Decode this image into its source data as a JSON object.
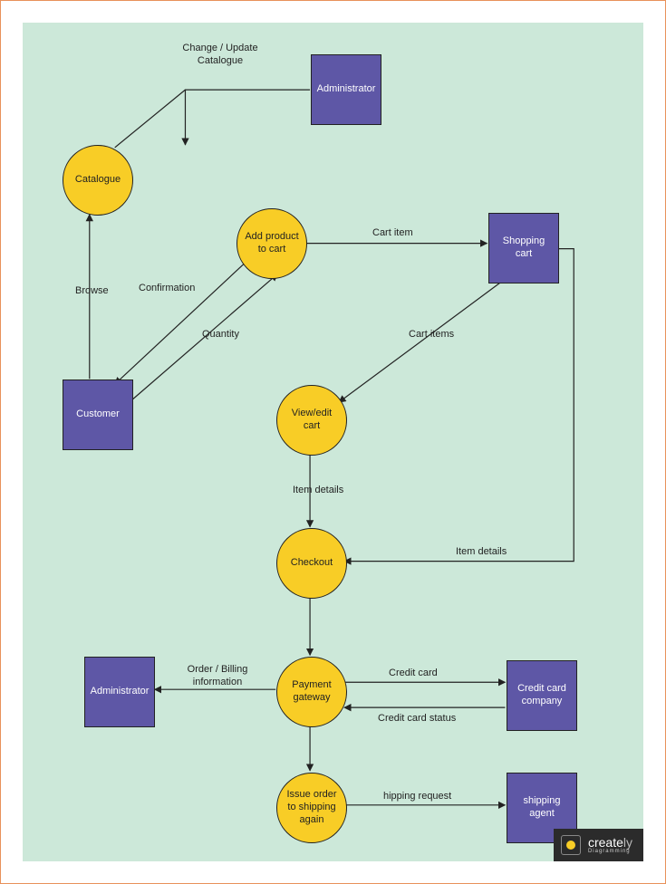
{
  "nodes": {
    "administrator_top": {
      "label": "Administrator"
    },
    "catalogue": {
      "label": "Catalogue"
    },
    "add_product": {
      "label": "Add product to cart"
    },
    "shopping_cart": {
      "label": "Shopping cart"
    },
    "customer": {
      "label": "Customer"
    },
    "view_edit_cart": {
      "label": "View/edit cart"
    },
    "checkout": {
      "label": "Checkout"
    },
    "administrator_bot": {
      "label": "Administrator"
    },
    "payment_gateway": {
      "label": "Payment gateway"
    },
    "credit_card_company": {
      "label": "Credit card company"
    },
    "issue_order": {
      "label": "Issue order to shipping again"
    },
    "shipping_agent": {
      "label": "shipping agent"
    }
  },
  "edges": {
    "change_update": {
      "label": "Change / Update Catalogue"
    },
    "browse": {
      "label": "Browse"
    },
    "confirmation": {
      "label": "Confirmation"
    },
    "quantity": {
      "label": "Quantity"
    },
    "cart_item": {
      "label": "Cart item"
    },
    "cart_items": {
      "label": "Cart items"
    },
    "item_details_1": {
      "label": "Item details"
    },
    "item_details_2": {
      "label": "Item details"
    },
    "order_billing": {
      "label": "Order / Billing information"
    },
    "credit_card": {
      "label": "Credit card"
    },
    "credit_status": {
      "label": "Credit card status"
    },
    "shipping_req": {
      "label": "hipping request"
    }
  },
  "branding": {
    "name": "creately",
    "tagline": "Diagramming"
  }
}
